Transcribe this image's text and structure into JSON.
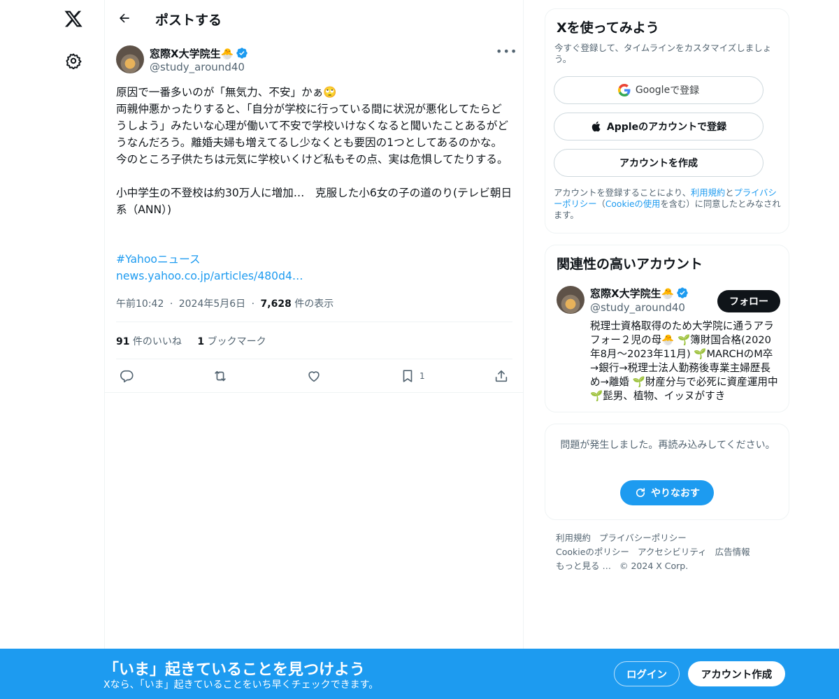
{
  "nav": {
    "logo_icon": "x-logo-icon",
    "settings_icon": "gear-icon"
  },
  "header": {
    "title": "ポストする"
  },
  "post": {
    "author_name": "窓際X大学院生🐣",
    "author_handle": "@study_around40",
    "text": "原因で一番多いのが「無気力、不安」かぁ🙄\n両親仲悪かったりすると、「自分が学校に行っている間に状況が悪化してたらどうしよう」みたいな心理が働いて不安で学校いけなくなると聞いたことあるがどうなんだろう。離婚夫婦も増えてるし少なくとも要因の1つとしてあるのかな。\n今のところ子供たちは元気に学校いくけど私もその点、実は危惧してたりする。\n\n小中学生の不登校は約30万人に増加…　克服した小6女の子の道のり(テレビ朝日系（ANN）)",
    "hashtag": "#Yahooニュース",
    "url": "news.yahoo.co.jp/articles/480d4…",
    "time": "午前10:42",
    "date": "2024年5月6日",
    "views_count": "7,628",
    "views_label": " 件の表示",
    "likes_count": "91",
    "likes_label": " 件のいいね",
    "bookmarks_count": "1",
    "bookmarks_label": " ブックマーク",
    "bookmark_action_count": "1",
    "separator": "·"
  },
  "signup_card": {
    "title": "Xを使ってみよう",
    "subtitle": "今すぐ登録して、タイムラインをカスタマイズしましょう。",
    "google_brand": "Google",
    "google_suffix": " で登録",
    "apple_label": "Appleのアカウントで登録",
    "create_label": "アカウントを作成",
    "legal_prefix": "アカウントを登録することにより、",
    "legal_terms": "利用規約",
    "legal_and": "と",
    "legal_privacy": "プライバシーポリシー",
    "legal_paren_open": "（",
    "legal_cookie": "Cookieの使用",
    "legal_suffix": "を含む）に同意したとみなされます。"
  },
  "related_card": {
    "title": "関連性の高いアカウント",
    "name": "窓際X大学院生🐣",
    "handle": "@study_around40",
    "follow_label": "フォロー",
    "bio": "税理士資格取得のため大学院に通うアラフォー２児の母🐣 🌱簿財国合格(2020年8月～2023年11月) 🌱MARCHのM卒→銀行→税理士法人勤務後専業主婦歴長め→離婚 🌱財産分与で必死に資産運用中 🌱髭男、植物、イッヌがすき"
  },
  "error_card": {
    "message": "問題が発生しました。再読み込みしてください。",
    "retry_label": "やりなおす"
  },
  "footer": {
    "links": [
      "利用規約",
      "プライバシーポリシー",
      "Cookieのポリシー",
      "アクセシビリティ",
      "広告情報",
      "もっと見る …"
    ],
    "copyright": "© 2024 X Corp."
  },
  "banner": {
    "title": "「いま」起きていることを見つけよう",
    "subtitle": "Xなら、「いま」起きていることをいち早くチェックできます。",
    "login_label": "ログイン",
    "signup_label": "アカウント作成"
  }
}
